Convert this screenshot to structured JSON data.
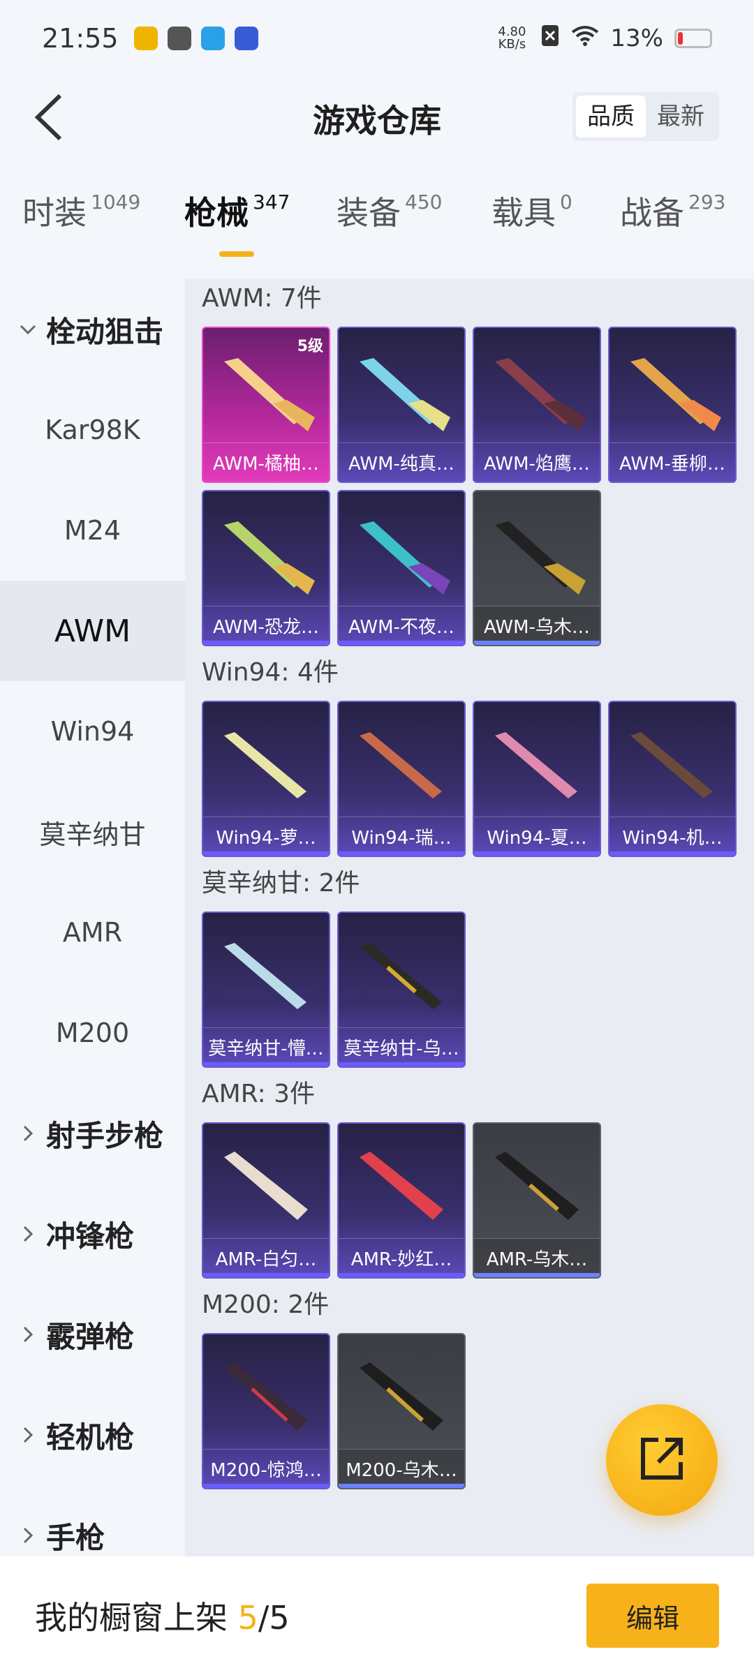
{
  "status_bar": {
    "time": "21:55",
    "net_speed_value": "4.80",
    "net_speed_unit": "KB/s",
    "battery": "13%"
  },
  "header": {
    "title": "游戏仓库",
    "sort_quality": "品质",
    "sort_latest": "最新"
  },
  "tabs": [
    {
      "label": "时装",
      "count": "1049"
    },
    {
      "label": "枪械",
      "count": "347"
    },
    {
      "label": "装备",
      "count": "450"
    },
    {
      "label": "载具",
      "count": "0"
    },
    {
      "label": "战备",
      "count": "293"
    }
  ],
  "sidebar": {
    "group_bolt": "栓动狙击",
    "items": [
      "Kar98K",
      "M24",
      "AWM",
      "Win94",
      "莫辛纳甘",
      "AMR",
      "M200"
    ],
    "groups": [
      "射手步枪",
      "冲锋枪",
      "霰弹枪",
      "轻机枪",
      "手枪"
    ]
  },
  "sections": [
    {
      "title": "AWM: 7件",
      "items": [
        "AWM-橘柚…",
        "AWM-纯真…",
        "AWM-焰鹰…",
        "AWM-垂柳…",
        "AWM-恐龙…",
        "AWM-不夜…",
        "AWM-乌木…"
      ],
      "badge": "5级"
    },
    {
      "title": "Win94: 4件",
      "items": [
        "Win94-萝…",
        "Win94-瑞…",
        "Win94-夏…",
        "Win94-机…"
      ]
    },
    {
      "title": "莫辛纳甘: 2件",
      "items": [
        "莫辛纳甘-懵…",
        "莫辛纳甘-乌…"
      ]
    },
    {
      "title": "AMR: 3件",
      "items": [
        "AMR-白匀…",
        "AMR-妙红…",
        "AMR-乌木…"
      ]
    },
    {
      "title": "M200: 2件",
      "items": [
        "M200-惊鸿…",
        "M200-乌木…"
      ]
    }
  ],
  "footer": {
    "prefix": "我的橱窗上架 ",
    "current": "5",
    "total": "/5",
    "edit_label": "编辑"
  }
}
